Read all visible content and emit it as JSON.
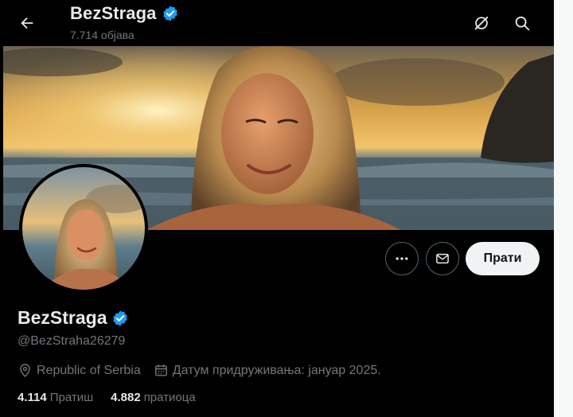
{
  "header": {
    "name": "BezStraga",
    "posts_count": "7.714 објава",
    "icons": [
      "back-arrow-icon",
      "grok-icon",
      "search-icon"
    ]
  },
  "profile": {
    "display_name": "BezStraga",
    "verified": true,
    "handle": "@BezStraha26279",
    "location": "Republic of Serbia",
    "joined": "Датум придруживања: јануар 2025.",
    "following_count": "4.114",
    "following_label": "Пратиш",
    "followers_count": "4.882",
    "followers_label": "пратиоца"
  },
  "actions": {
    "follow_label": "Прати",
    "more_icon": "more-icon",
    "message_icon": "mail-icon"
  },
  "colors": {
    "background": "#000000",
    "text_primary": "#e7e9ea",
    "text_secondary": "#71767b",
    "verified_badge": "#1d9bf0",
    "follow_button_bg": "#eff3f4"
  }
}
